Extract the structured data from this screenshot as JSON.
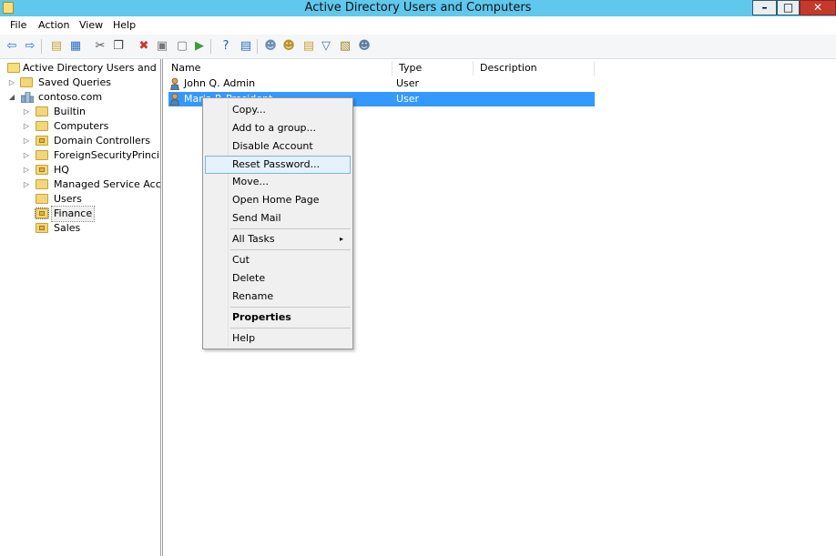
{
  "window": {
    "title": "Active Directory Users and Computers",
    "minimize": "–",
    "maximize": "□",
    "close": "✕"
  },
  "menu": [
    "File",
    "Action",
    "View",
    "Help"
  ],
  "toolbar": {
    "icons": [
      {
        "name": "back-icon",
        "glyph": "⇦",
        "color": "#2a6fc4"
      },
      {
        "name": "forward-icon",
        "glyph": "⇨",
        "color": "#2a6fc4"
      },
      {
        "name": "up-folder-icon",
        "glyph": "▤",
        "color": "#c9a13a"
      },
      {
        "name": "show-hide-tree-icon",
        "glyph": "▦",
        "color": "#2a6fc4"
      },
      {
        "name": "cut-icon",
        "glyph": "✂",
        "color": "#555"
      },
      {
        "name": "copy-icon",
        "glyph": "❐",
        "color": "#444"
      },
      {
        "name": "delete-icon",
        "glyph": "✖",
        "color": "#d62f2f"
      },
      {
        "name": "properties-icon",
        "glyph": "▣",
        "color": "#777"
      },
      {
        "name": "refresh-icon",
        "glyph": "▢",
        "color": "#777"
      },
      {
        "name": "export-list-icon",
        "glyph": "▶",
        "color": "#3e9a3e"
      },
      {
        "name": "help-icon",
        "glyph": "?",
        "color": "#1f5fbf"
      },
      {
        "name": "console-icon",
        "glyph": "▤",
        "color": "#2a6fc4"
      },
      {
        "name": "new-user-icon",
        "glyph": "☻",
        "color": "#6e8fb0"
      },
      {
        "name": "new-group-icon",
        "glyph": "☻",
        "color": "#b8962a"
      },
      {
        "name": "new-ou-icon",
        "glyph": "▤",
        "color": "#c9a13a"
      },
      {
        "name": "filter-icon",
        "glyph": "▽",
        "color": "#4a6ea3"
      },
      {
        "name": "find-icon",
        "glyph": "▧",
        "color": "#a08b2a"
      },
      {
        "name": "add-to-group-icon",
        "glyph": "☻",
        "color": "#5e7f9d"
      }
    ]
  },
  "tree": {
    "root": "Active Directory Users and Com",
    "saved_queries": "Saved Queries",
    "domain": "contoso.com",
    "children": [
      "Builtin",
      "Computers",
      "Domain Controllers",
      "ForeignSecurityPrincipals",
      "HQ",
      "Managed Service Accour",
      "Users",
      "Finance",
      "Sales"
    ]
  },
  "list": {
    "columns": [
      "Name",
      "Type",
      "Description"
    ],
    "rows": [
      {
        "name": "John Q. Admin",
        "type": "User",
        "description": ""
      },
      {
        "name": "Maria P. President",
        "type": "User",
        "description": ""
      }
    ]
  },
  "context_menu": {
    "items": [
      "Copy...",
      "Add to a group...",
      "Disable Account",
      "Reset Password...",
      "Move...",
      "Open Home Page",
      "Send Mail",
      "All Tasks",
      "Cut",
      "Delete",
      "Rename",
      "Properties",
      "Help"
    ],
    "submenu_arrow": "▸"
  },
  "colors": {
    "titlebar": "#5fc8ec",
    "selection": "#3399ff",
    "menu_highlight": "#e5f1fb"
  }
}
